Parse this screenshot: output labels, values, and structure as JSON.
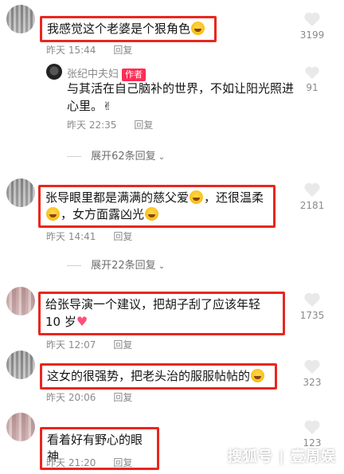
{
  "comments": [
    {
      "text": "我感觉这个老婆是个狠角色",
      "time": "昨天 15:44",
      "reply": "回复",
      "likes": "3199"
    },
    {
      "text_part1": "张导眼里都是满满的慈父爱",
      "text_part2": "，还很温柔",
      "text_part3": "，女方面露凶光",
      "time": "昨天 14:41",
      "reply": "回复",
      "likes": "2181"
    },
    {
      "text": "给张导演一个建议，把胡子刮了应该年轻 10 岁",
      "time": "昨天 12:07",
      "reply": "回复",
      "likes": "1735"
    },
    {
      "text": "这女的很强势，把老头治的服服帖帖的",
      "time": "昨天 20:06",
      "reply": "回复",
      "likes": "323"
    },
    {
      "text": "看着好有野心的眼神",
      "time": "昨天 21:20",
      "reply": "回复",
      "likes": "123"
    }
  ],
  "author_reply": {
    "name": "张纪中夫妇",
    "tag": "作者",
    "text": "与其活在自己脑补的世界，不如让阳光照进心里。",
    "time": "昨天 22:35",
    "reply": "回复",
    "likes": "91"
  },
  "expand": [
    {
      "label": "展开62条回复"
    },
    {
      "label": "展开22条回复"
    }
  ],
  "watermark": "搜狐号 | 壹周娱",
  "colors": {
    "highlight": "#e8271e",
    "author_tag": "#fe2c55",
    "muted": "#8a8a8a"
  }
}
